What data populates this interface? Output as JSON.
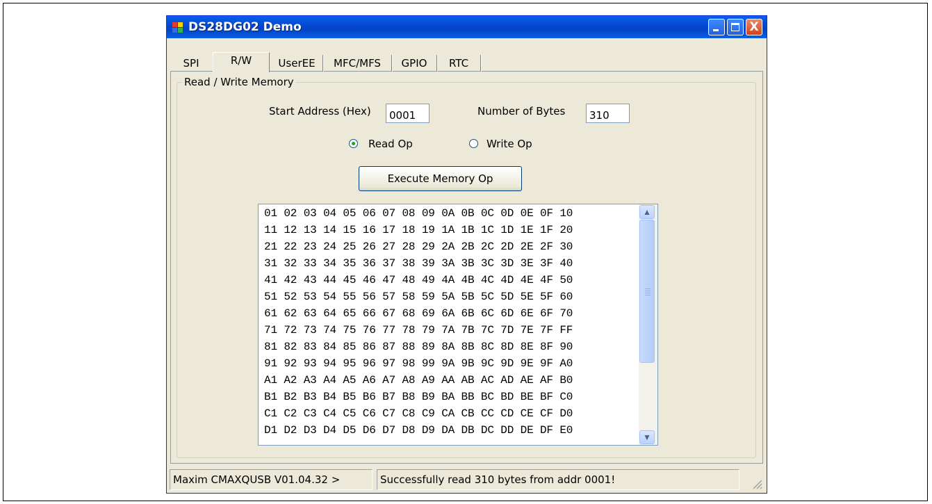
{
  "window": {
    "title": "DS28DG02 Demo",
    "buttons": {
      "minimize": "minimize-icon",
      "maximize": "maximize-icon",
      "close": "close-icon"
    },
    "close_glyph": "X"
  },
  "tabs": [
    {
      "label": "SPI",
      "selected": false
    },
    {
      "label": "R/W",
      "selected": true
    },
    {
      "label": "UserEE",
      "selected": false
    },
    {
      "label": "MFC/MFS",
      "selected": false
    },
    {
      "label": "GPIO",
      "selected": false
    },
    {
      "label": "RTC",
      "selected": false
    }
  ],
  "group": {
    "title": "Read / Write Memory"
  },
  "form": {
    "start_address_label": "Start Address (Hex)",
    "start_address_value": "0001",
    "num_bytes_label": "Number of Bytes",
    "num_bytes_value": "310",
    "read_op_label": "Read Op",
    "write_op_label": "Write Op",
    "selected_op": "Read Op",
    "execute_label": "Execute Memory Op"
  },
  "memory_lines": [
    "01 02 03 04 05 06 07 08 09 0A 0B 0C 0D 0E 0F 10",
    "11 12 13 14 15 16 17 18 19 1A 1B 1C 1D 1E 1F 20",
    "21 22 23 24 25 26 27 28 29 2A 2B 2C 2D 2E 2F 30",
    "31 32 33 34 35 36 37 38 39 3A 3B 3C 3D 3E 3F 40",
    "41 42 43 44 45 46 47 48 49 4A 4B 4C 4D 4E 4F 50",
    "51 52 53 54 55 56 57 58 59 5A 5B 5C 5D 5E 5F 60",
    "61 62 63 64 65 66 67 68 69 6A 6B 6C 6D 6E 6F 70",
    "71 72 73 74 75 76 77 78 79 7A 7B 7C 7D 7E 7F FF",
    "81 82 83 84 85 86 87 88 89 8A 8B 8C 8D 8E 8F 90",
    "91 92 93 94 95 96 97 98 99 9A 9B 9C 9D 9E 9F A0",
    "A1 A2 A3 A4 A5 A6 A7 A8 A9 AA AB AC AD AE AF B0",
    "B1 B2 B3 B4 B5 B6 B7 B8 B9 BA BB BC BD BE BF C0",
    "C1 C2 C3 C4 C5 C6 C7 C8 C9 CA CB CC CD CE CF D0",
    "D1 D2 D3 D4 D5 D6 D7 D8 D9 DA DB DC DD DE DF E0"
  ],
  "scroll": {
    "up_glyph": "▲",
    "down_glyph": "▼"
  },
  "status": {
    "left": "Maxim CMAXQUSB V01.04.32 >",
    "right": "Successfully read 310 bytes from addr 0001!"
  },
  "colors": {
    "titlebar": "#0a5fe8",
    "window_bg": "#ece9d8",
    "close_button": "#d2431a",
    "radio_dot": "#21a121"
  }
}
